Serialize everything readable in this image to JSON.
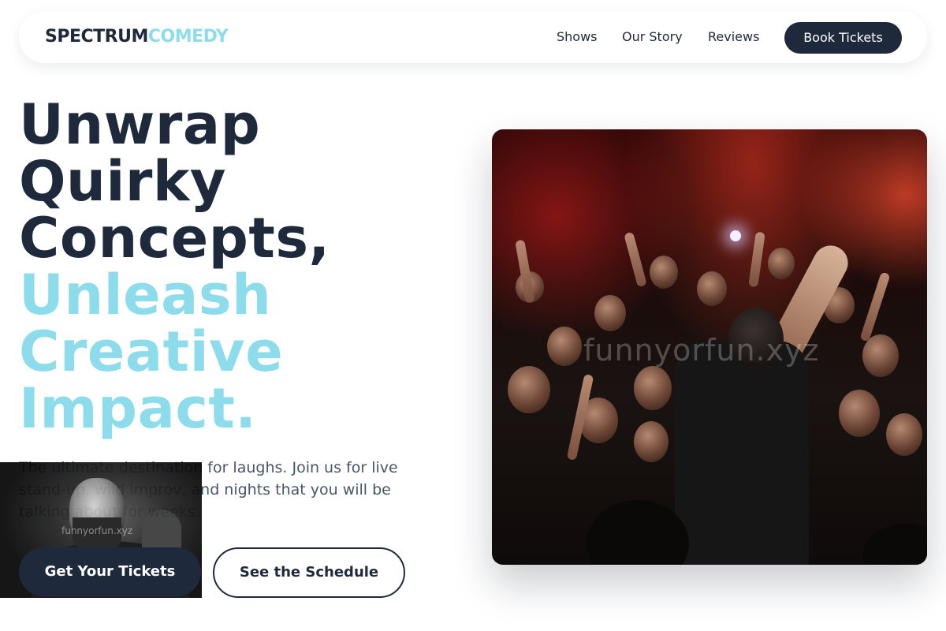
{
  "nav": {
    "logo_part1": "SPECTRUM",
    "logo_part2": "COMEDY",
    "links": [
      "Shows",
      "Our Story",
      "Reviews"
    ],
    "cta": "Book Tickets"
  },
  "hero": {
    "headline_dark": [
      "Unwrap",
      "Quirky",
      "Concepts,"
    ],
    "headline_light": [
      "Unleash",
      "Creative",
      "Impact."
    ],
    "subtext": "The ultimate destination for laughs. Join us for live stand-up, wild improv, and nights that you will be talking about for weeks.",
    "primary_button": "Get Your Tickets",
    "secondary_button": "See the Schedule",
    "image_watermark": "funnyorfun.xyz",
    "thumb_watermark": "funnyorfun.xyz"
  },
  "colors": {
    "dark": "#1e293b",
    "accent": "#8ddcec",
    "muted": "#475569"
  }
}
